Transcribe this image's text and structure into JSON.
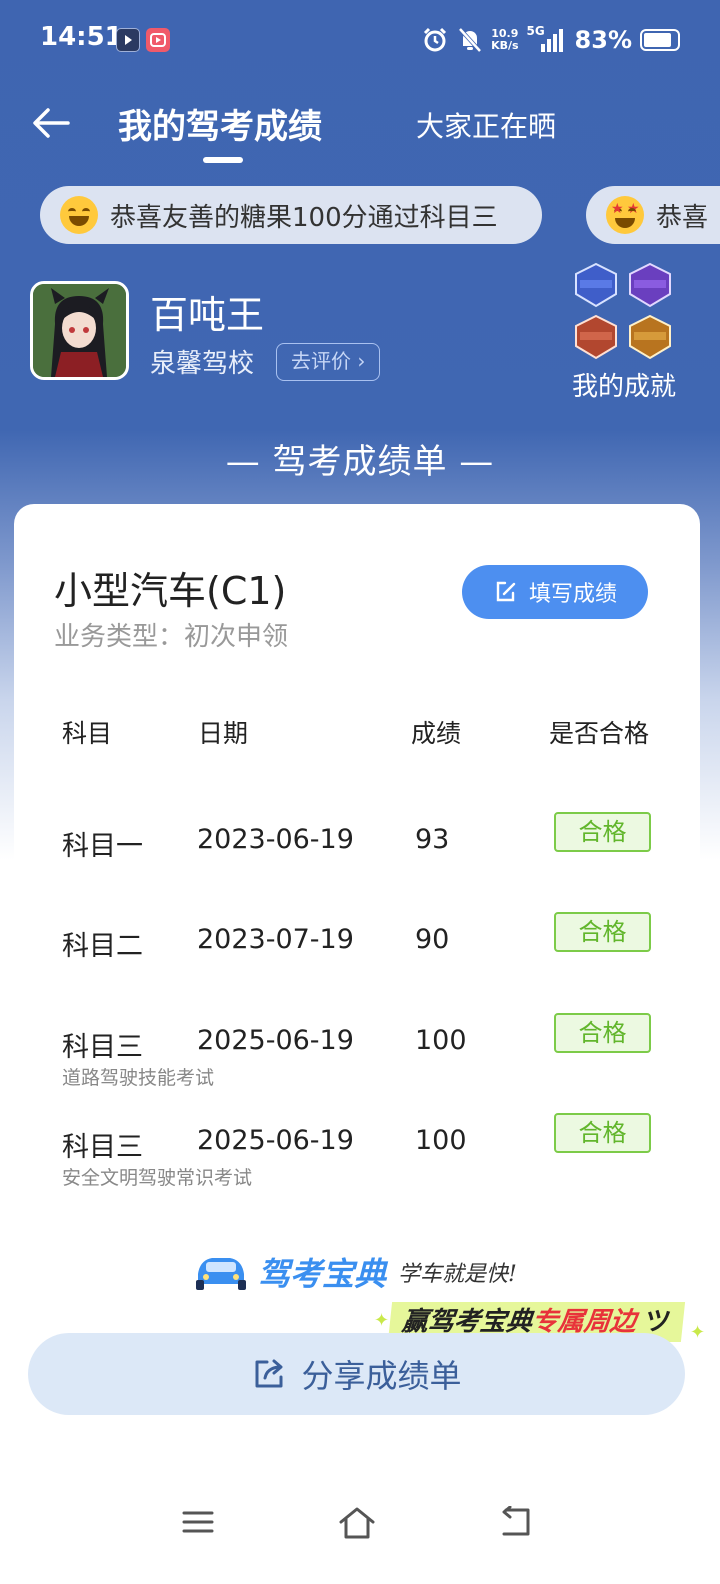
{
  "status": {
    "time": "14:51",
    "net_speed_value": "10.9",
    "net_speed_unit": "KB/s",
    "network": "5G",
    "battery": "83%"
  },
  "nav": {
    "tab_active": "我的驾考成绩",
    "tab_other": "大家正在晒"
  },
  "ticker": {
    "item1": "恭喜友善的糖果100分通过科目三",
    "item2": "恭喜"
  },
  "profile": {
    "name": "百吨王",
    "school": "泉馨驾校",
    "review_label": "去评价",
    "achievement_label": "我的成就"
  },
  "section_title": "— 驾考成绩单 —",
  "card": {
    "car_type": "小型汽车(C1)",
    "business_label": "业务类型：",
    "business_value": "初次申领",
    "fill_button": "填写成绩",
    "headers": {
      "subject": "科目",
      "date": "日期",
      "score": "成绩",
      "passed": "是否合格"
    },
    "rows": [
      {
        "subject": "科目一",
        "date": "2023-06-19",
        "score": "93",
        "status": "合格",
        "note": ""
      },
      {
        "subject": "科目二",
        "date": "2023-07-19",
        "score": "90",
        "status": "合格",
        "note": ""
      },
      {
        "subject": "科目三",
        "date": "2025-06-19",
        "score": "100",
        "status": "合格",
        "note": "道路驾驶技能考试"
      },
      {
        "subject": "科目三",
        "date": "2025-06-19",
        "score": "100",
        "status": "合格",
        "note": "安全文明驾驶常识考试"
      }
    ]
  },
  "brand": {
    "name": "驾考宝典",
    "slogan": "学车就是快!",
    "promo_main": "赢驾考宝典",
    "promo_accent": "专属周边"
  },
  "share_button": "分享成绩单",
  "colors": {
    "header_blue": "#4067b2",
    "button_blue": "#4d8ff0",
    "pass_green": "#62b62c"
  }
}
